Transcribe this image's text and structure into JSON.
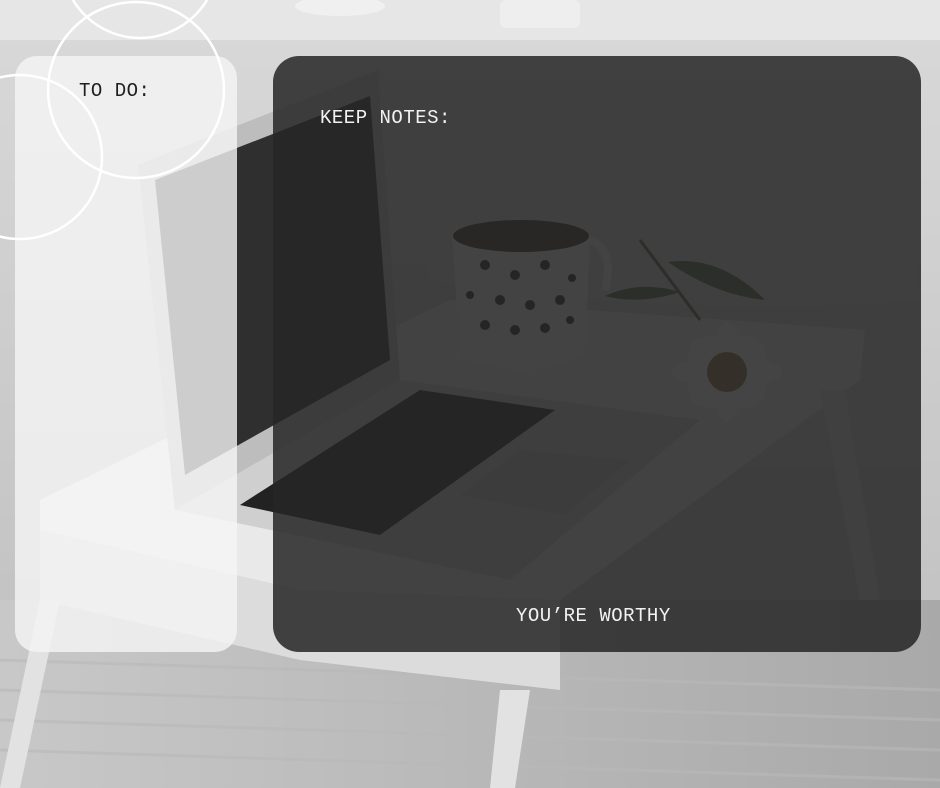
{
  "todo": {
    "label": "TO DO:"
  },
  "notes": {
    "label": "KEEP NOTES:"
  },
  "footer": {
    "text": "YOU’RE WORTHY"
  },
  "colors": {
    "dark_panel": "#262626",
    "light_panel": "#f5f5f5",
    "ring": "#ffffff"
  }
}
